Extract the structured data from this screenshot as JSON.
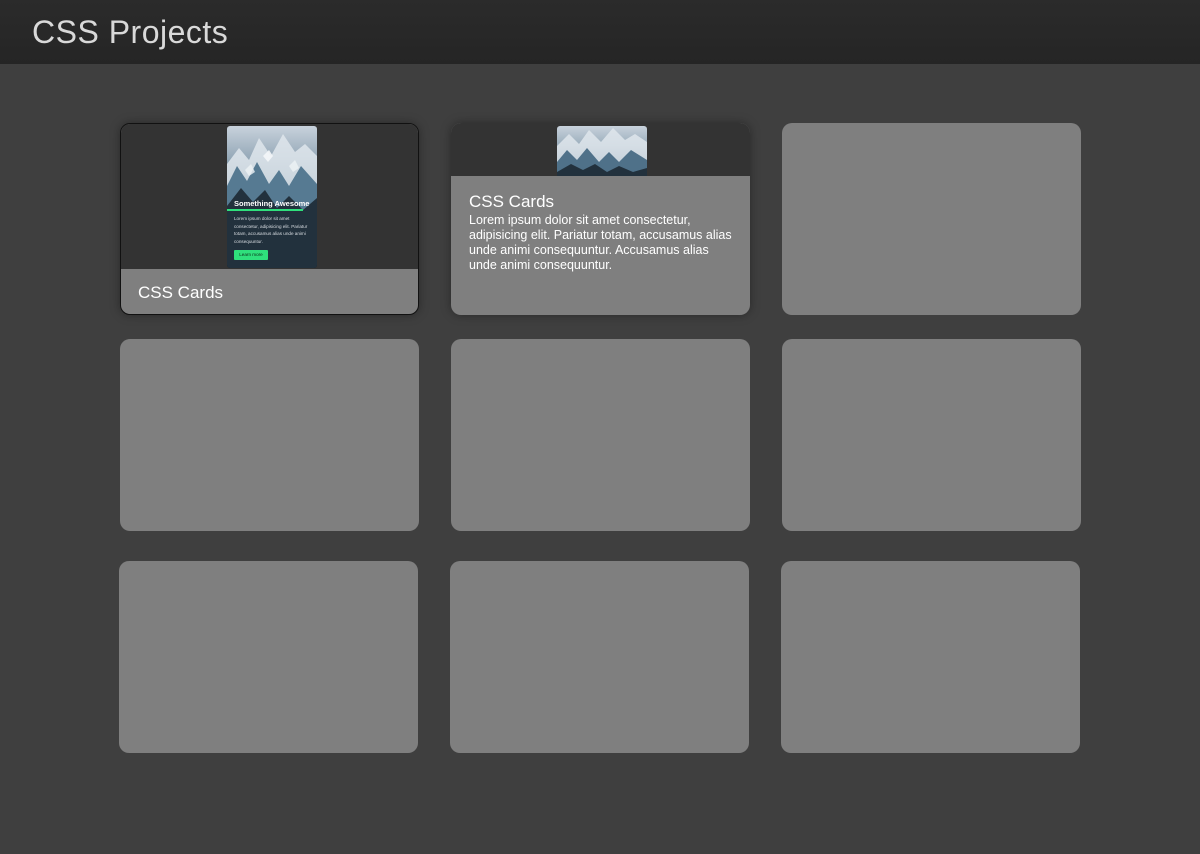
{
  "header": {
    "title": "CSS Projects"
  },
  "cards": [
    {
      "label": "CSS Cards",
      "preview": {
        "title": "Something Awesome",
        "text": "Lorem ipsum dolor sit amet consectetur, adipisicing elit. Pariatur totam, accusamus alias unde animi consequuntur.",
        "button": "Learn more"
      }
    },
    {
      "title": "CSS Cards",
      "text": "Lorem ipsum dolor sit amet consectetur, adipisicing elit. Pariatur totam, accusamus alias unde animi consequuntur. Accusamus alias unde animi consequuntur."
    }
  ],
  "colors": {
    "page_background": "#3f3f3f",
    "header_background": "#262626",
    "card_background": "#7f7f7f",
    "preview_background": "#333333",
    "accent": "#2fe07c"
  },
  "icons": [
    "mountain-image"
  ]
}
